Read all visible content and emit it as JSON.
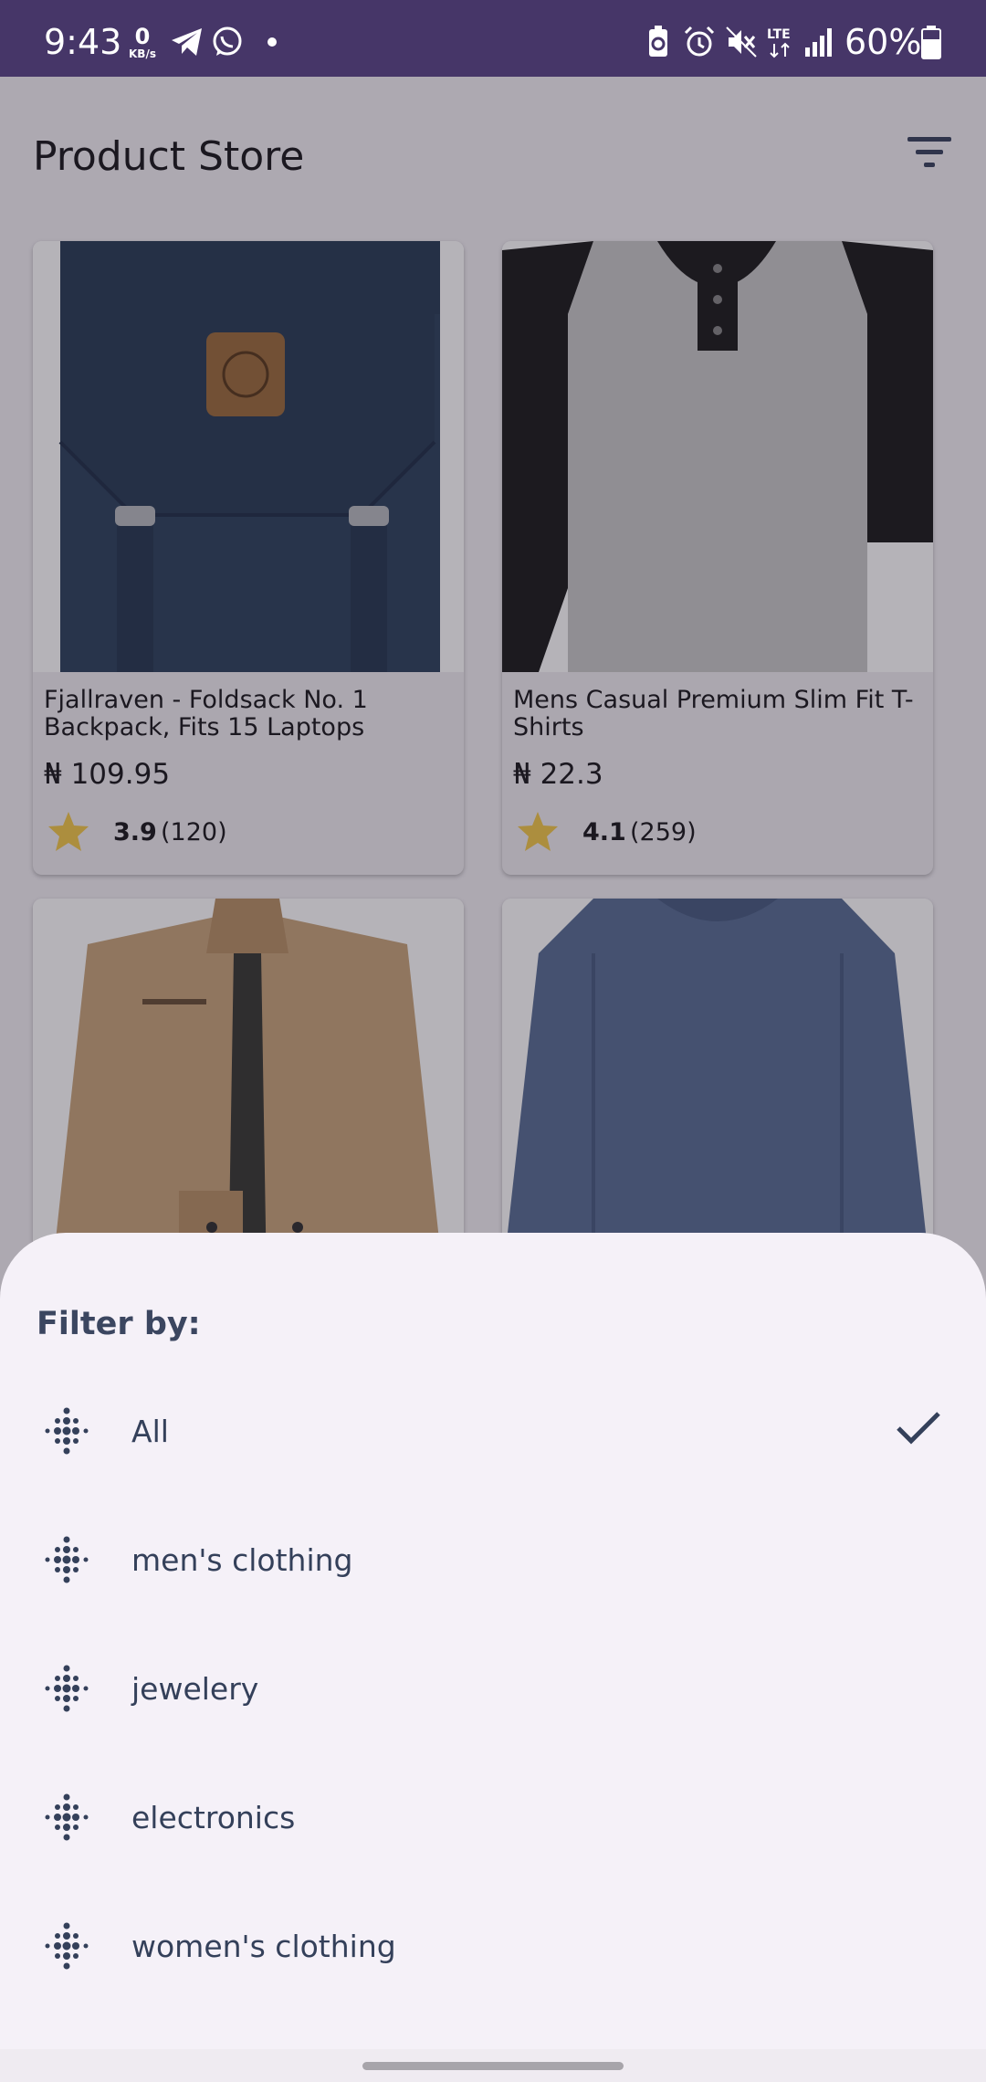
{
  "status_bar": {
    "time": "9:43",
    "net_speed_value": "0",
    "net_speed_unit": "KB/s",
    "network_label": "LTE",
    "battery_percent": "60%",
    "icons": [
      "telegram-icon",
      "whatsapp-icon",
      "dot-icon",
      "battery-saver-icon",
      "alarm-icon",
      "mute-icon",
      "lte-icon",
      "signal-icon",
      "battery-icon"
    ]
  },
  "app": {
    "title": "Product Store",
    "filter_icon": "filter-list-icon"
  },
  "products": [
    {
      "title": "Fjallraven - Foldsack No. 1 Backpack, Fits 15 Laptops",
      "price": "₦ 109.95",
      "rating": "3.9",
      "count": "(120)"
    },
    {
      "title": "Mens Casual Premium Slim Fit T-Shirts",
      "price": "₦ 22.3",
      "rating": "4.1",
      "count": "(259)"
    },
    {
      "title": "",
      "price": "",
      "rating": "",
      "count": ""
    },
    {
      "title": "",
      "price": "",
      "rating": "",
      "count": ""
    }
  ],
  "sheet": {
    "title": "Filter by:",
    "options": [
      {
        "label": "All",
        "selected": true
      },
      {
        "label": "men's clothing",
        "selected": false
      },
      {
        "label": "jewelery",
        "selected": false
      },
      {
        "label": "electronics",
        "selected": false
      },
      {
        "label": "women's clothing",
        "selected": false
      }
    ]
  },
  "colors": {
    "status_bar": "#463668",
    "accent": "#34405a",
    "star": "#f2c94c",
    "sheet": "#f5f1f8"
  }
}
